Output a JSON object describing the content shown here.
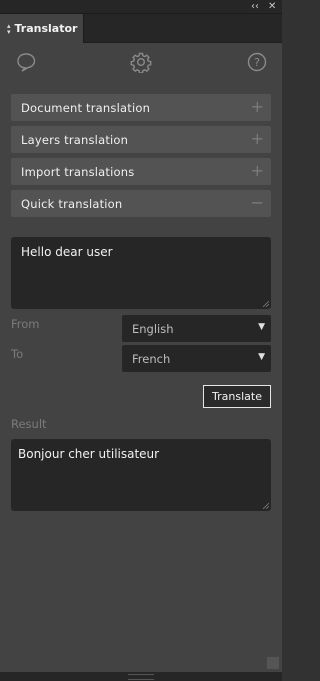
{
  "window": {
    "collapse_icon": "double-chevron-left-icon",
    "close_icon": "close-icon"
  },
  "tab": {
    "title": "Translator",
    "icon": "up-down-arrows-icon"
  },
  "toolbar": {
    "icons": [
      "chat-bubble-icon",
      "gear-icon",
      "help-icon"
    ]
  },
  "sections": [
    {
      "label": "Document translation",
      "state": "+"
    },
    {
      "label": "Layers translation",
      "state": "+"
    },
    {
      "label": "Import translations",
      "state": "+"
    },
    {
      "label": "Quick translation",
      "state": "−"
    }
  ],
  "quick": {
    "input_text": "Hello dear user",
    "from_label": "From",
    "from_value": "English",
    "to_label": "To",
    "to_value": "French",
    "translate_label": "Translate",
    "result_label": "Result",
    "result_text": "Bonjour cher utilisateur"
  }
}
